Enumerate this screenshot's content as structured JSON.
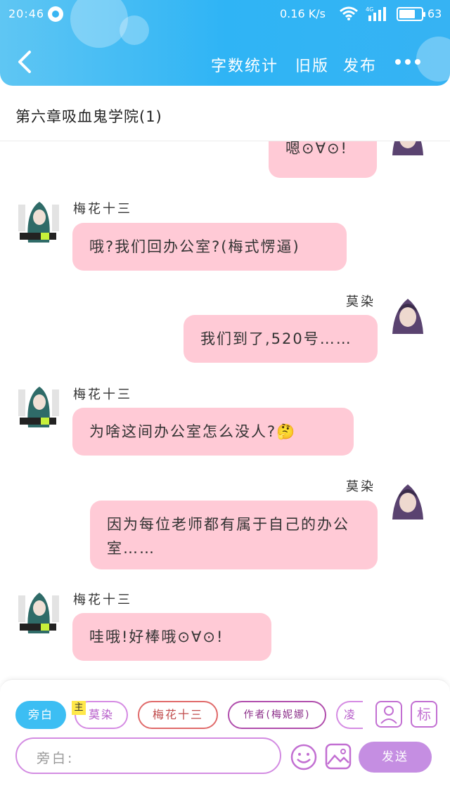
{
  "status_bar": {
    "time": "20:46",
    "network_speed": "0.16 K/s",
    "network_type": "4G",
    "battery": "63"
  },
  "nav": {
    "word_count": "字数统计",
    "old_version": "旧版",
    "publish": "发布"
  },
  "chapter": {
    "title": "第六章吸血鬼学院(1)"
  },
  "messages": [
    {
      "sender": "莫染",
      "side": "right",
      "text": "嗯⊙∀⊙!"
    },
    {
      "sender": "梅花十三",
      "side": "left",
      "text": "哦?我们回办公室?(梅式愣逼)"
    },
    {
      "sender": "莫染",
      "side": "right",
      "text": "我们到了,520号……"
    },
    {
      "sender": "梅花十三",
      "side": "left",
      "text": "为啥这间办公室怎么没人?🤔"
    },
    {
      "sender": "莫染",
      "side": "right",
      "text": "因为每位老师都有属于自己的办公室……"
    },
    {
      "sender": "梅花十三",
      "side": "left",
      "text": "哇哦!好棒哦⊙∀⊙!"
    }
  ],
  "toolbar": {
    "roles": [
      {
        "label": "旁白",
        "active": true
      },
      {
        "label": "莫染",
        "tag": "主",
        "active": false
      },
      {
        "label": "梅花十三",
        "active": false
      },
      {
        "label": "作者(梅妮娜)",
        "active": false
      },
      {
        "label": "凌",
        "active": false
      }
    ],
    "tag_icon_text": "标",
    "input_placeholder": "旁白:",
    "send_label": "发送"
  },
  "colors": {
    "header": "#2fb4f5",
    "bubble": "#ffcad6",
    "accent": "#c58ee2",
    "chip_active": "#3cbef3"
  }
}
